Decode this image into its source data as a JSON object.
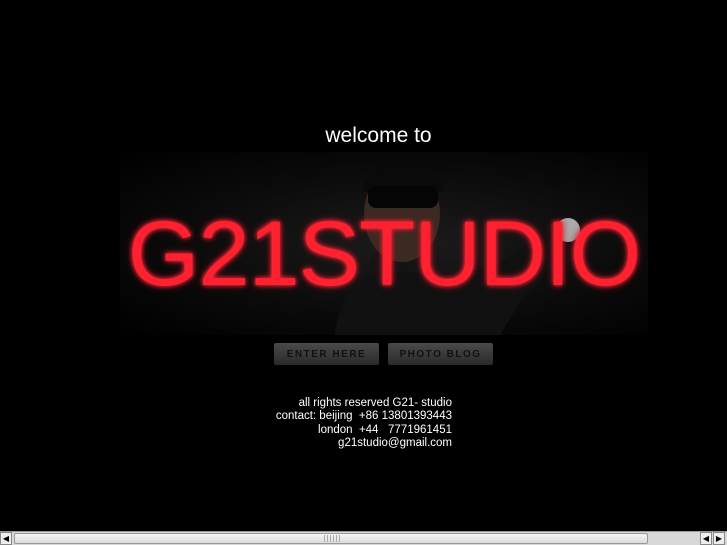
{
  "welcome": "welcome to",
  "logo_text": "G21STUDIO",
  "buttons": {
    "enter": "ENTER HERE",
    "blog": "PHOTO BLOG"
  },
  "footer": {
    "line1": "all rights reserved G21- studio",
    "line2": "contact: beijing  +86 13801393443",
    "line3": "london  +44   7771961451",
    "line4": "g21studio@gmail.com"
  },
  "colors": {
    "neon": "#ff2030",
    "background": "#000000"
  },
  "icons": {
    "left": "arrow-left-icon",
    "right": "arrow-right-icon"
  }
}
